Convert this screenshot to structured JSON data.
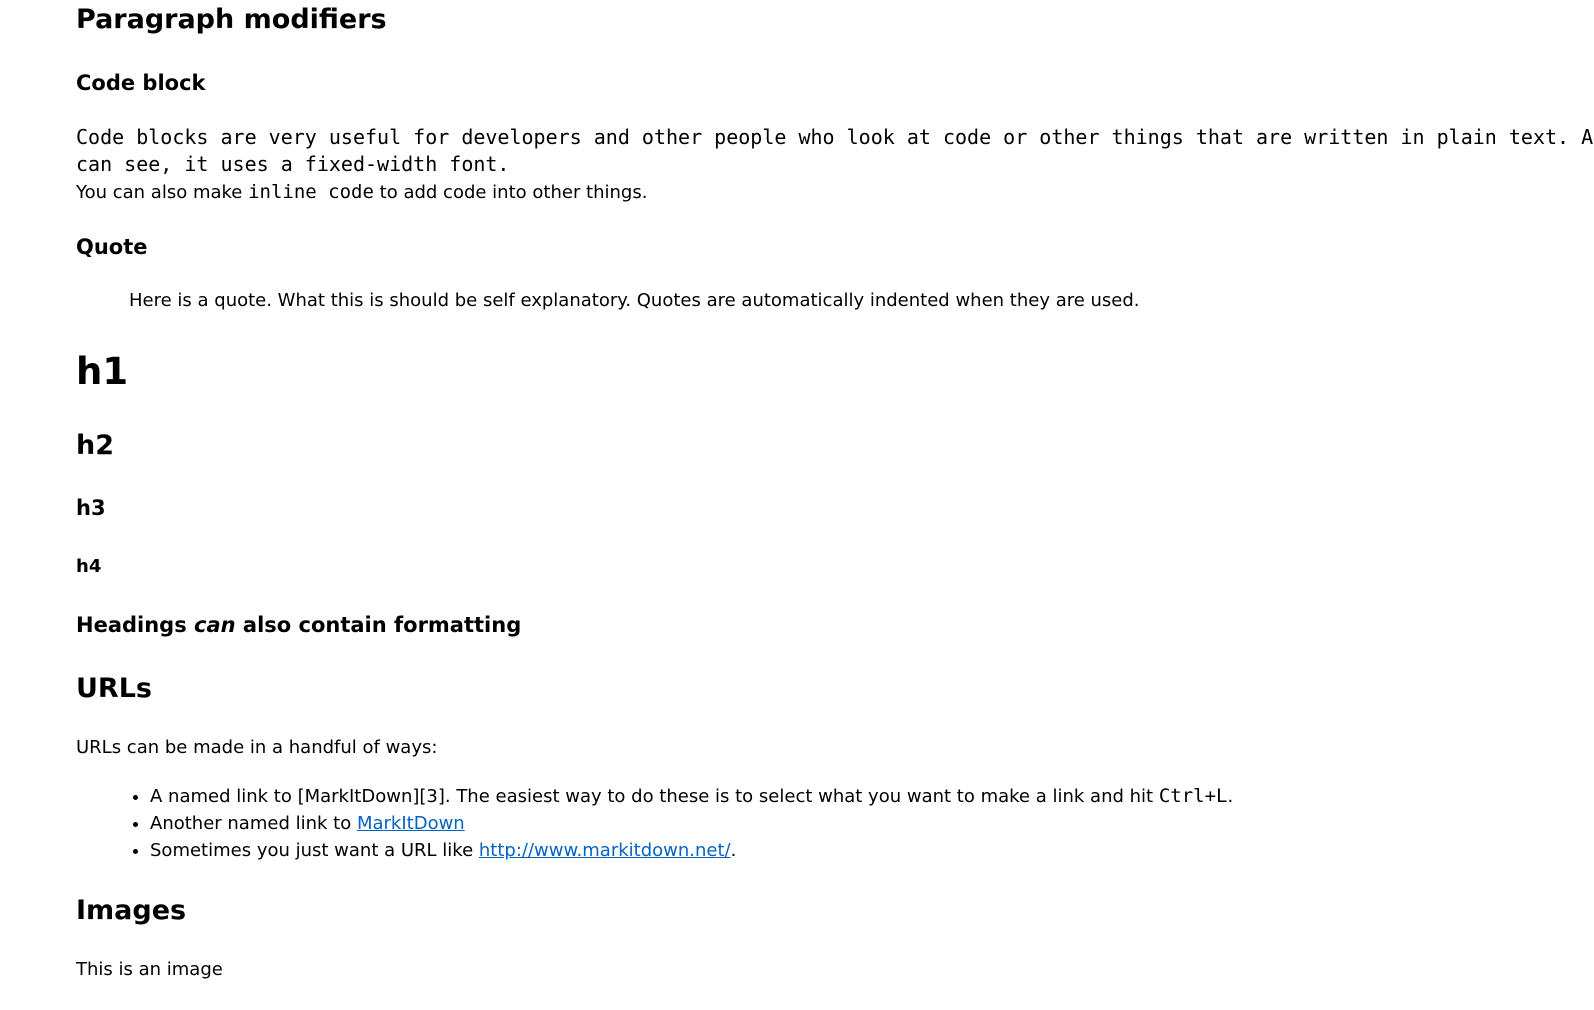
{
  "sections": {
    "paragraph_modifiers": "Paragraph modifiers",
    "code_block": {
      "heading": "Code block",
      "line1": "Code blocks are very useful for developers and other people who look at code or other things that are written in plain text. As you",
      "line2": "can see, it uses a fixed-width font.",
      "inline_pre": "You can also make ",
      "inline_code": "inline code",
      "inline_post": " to add code into other things."
    },
    "quote": {
      "heading": "Quote",
      "text": "Here is a quote. What this is should be self explanatory. Quotes are automatically indented when they are used."
    },
    "headings": {
      "h1": "h1",
      "h2": "h2",
      "h3": "h3",
      "h4": "h4",
      "formatted_pre": "Headings ",
      "formatted_em": "can",
      "formatted_post": " also contain formatting"
    },
    "urls": {
      "heading": "URLs",
      "intro": "URLs can be made in a handful of ways:",
      "items": [
        {
          "pre": "A named link to [MarkItDown][3]. The easiest way to do these is to select what you want to make a link and hit ",
          "code": "Ctrl+L",
          "post": "."
        },
        {
          "pre": "Another named link to ",
          "link": "MarkItDown",
          "post": ""
        },
        {
          "pre": "Sometimes you just want a URL like ",
          "link": "http://www.markitdown.net/",
          "post": "."
        }
      ]
    },
    "images": {
      "heading": "Images",
      "text": "This is an image"
    }
  },
  "colors": {
    "link": "#0563c1",
    "text": "#000000",
    "background": "#ffffff"
  }
}
